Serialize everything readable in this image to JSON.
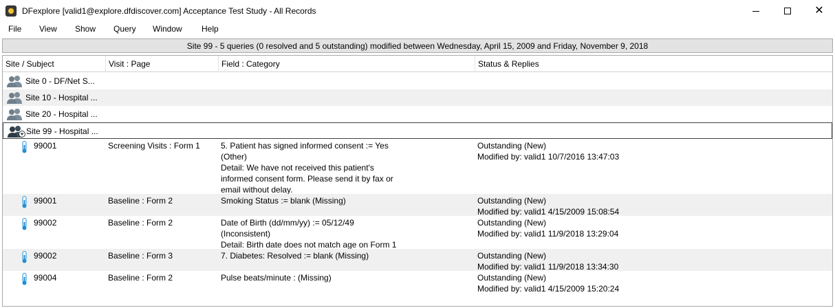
{
  "window": {
    "title": "DFexplore [valid1@explore.dfdiscover.com] Acceptance Test Study - All Records",
    "minimize_label": "—",
    "close_label": "✕"
  },
  "menu": [
    "File",
    "View",
    "Show",
    "Query",
    "Window",
    "Help"
  ],
  "summary": "Site 99 - 5 queries (0 resolved and 5 outstanding) modified between Wednesday, April 15, 2009 and Friday, November 9, 2018",
  "columns": [
    "Site / Subject",
    "Visit : Page",
    "Field : Category",
    "Status & Replies"
  ],
  "sites": [
    {
      "label": "Site 0 - DF/Net S..."
    },
    {
      "label": "Site 10 - Hospital ..."
    },
    {
      "label": "Site 20 - Hospital ..."
    },
    {
      "label": "Site 99 - Hospital ..."
    }
  ],
  "queries": [
    {
      "subject": "99001",
      "visit_page": "Screening Visits : Form 1",
      "field_lines": [
        "5. Patient has signed informed consent := Yes",
        "(Other)",
        "Detail: We have not received this patient's",
        "informed consent form. Please send it by fax or",
        "email without delay."
      ],
      "status_lines": [
        "Outstanding (New)",
        "Modified by: valid1 10/7/2016 13:47:03"
      ]
    },
    {
      "subject": "99001",
      "visit_page": "Baseline : Form 2",
      "field_lines": [
        "Smoking Status := blank (Missing)"
      ],
      "status_lines": [
        "Outstanding (New)",
        "Modified by: valid1 4/15/2009 15:08:54"
      ]
    },
    {
      "subject": "99002",
      "visit_page": "Baseline : Form 2",
      "field_lines": [
        "Date of Birth (dd/mm/yy) := 05/12/49",
        "(Inconsistent)",
        "Detail: Birth date does not match age on Form 1"
      ],
      "status_lines": [
        "Outstanding (New)",
        "Modified by: valid1 11/9/2018 13:29:04"
      ]
    },
    {
      "subject": "99002",
      "visit_page": "Baseline : Form 3",
      "field_lines": [
        "7. Diabetes: Resolved := blank (Missing)"
      ],
      "status_lines": [
        "Outstanding (New)",
        "Modified by: valid1 11/9/2018 13:34:30"
      ]
    },
    {
      "subject": "99004",
      "visit_page": "Baseline : Form 2",
      "field_lines": [
        "Pulse beats/minute : (Missing)"
      ],
      "status_lines": [
        "Outstanding (New)",
        "Modified by: valid1 4/15/2009 15:20:24"
      ]
    }
  ],
  "colors": {
    "summary_bg": "#e3e3e3",
    "alt_row": "#f0f0f0",
    "site_icon": "#6f7f8c",
    "query_icon": "#1f8fd6"
  },
  "icons": {
    "app": "dfexplore-app-icon",
    "site": "people-group-icon",
    "query": "thermometer-query-icon"
  }
}
